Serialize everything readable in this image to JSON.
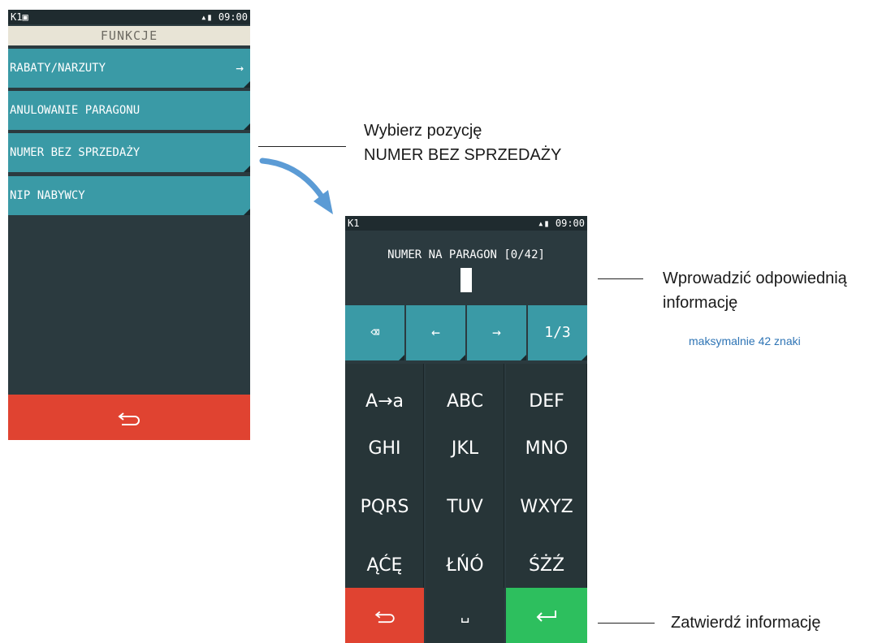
{
  "screen1": {
    "status": {
      "left": "K1▣",
      "right": "▴▮ 09:00"
    },
    "title": "FUNKCJE",
    "menu": [
      {
        "label": "RABATY/NARZUTY",
        "arrow": "→"
      },
      {
        "label": "ANULOWANIE PARAGONU"
      },
      {
        "label": "NUMER BEZ SPRZEDAŻY"
      },
      {
        "label": "NIP NABYWCY"
      }
    ],
    "back_icon": "⬿"
  },
  "screen2": {
    "status": {
      "left": "K1",
      "right": "▴▮ 09:00"
    },
    "prompt": "NUMER NA PARAGON [0/42]",
    "toolbar": {
      "backspace": "⌫",
      "left": "←",
      "right": "→",
      "page": "1/3"
    },
    "keys": [
      [
        "A→a",
        "ABC",
        "DEF"
      ],
      [
        "GHI",
        "JKL",
        "MNO"
      ],
      [
        "PQRS",
        "TUV",
        "WXYZ"
      ],
      [
        "ĄĆĘ",
        "ŁŃÓ",
        "ŚŻŹ"
      ]
    ],
    "bottom": {
      "back": "⬿",
      "space": "␣",
      "enter": "↵"
    }
  },
  "annotations": {
    "select_line1": "Wybierz pozycję",
    "select_line2": "NUMER BEZ SPRZEDAŻY",
    "input_line1": "Wprowadzić odpowiednią",
    "input_line2": "informację",
    "input_note": "maksymalnie 42 znaki",
    "confirm": "Zatwierdź informację"
  },
  "colors": {
    "accent": "#3a9aa6",
    "back": "#e04331",
    "confirm": "#2dbf5e",
    "screen_bg": "#2b3a3f",
    "arrow": "#5b9bd5",
    "note": "#2e74b5"
  }
}
